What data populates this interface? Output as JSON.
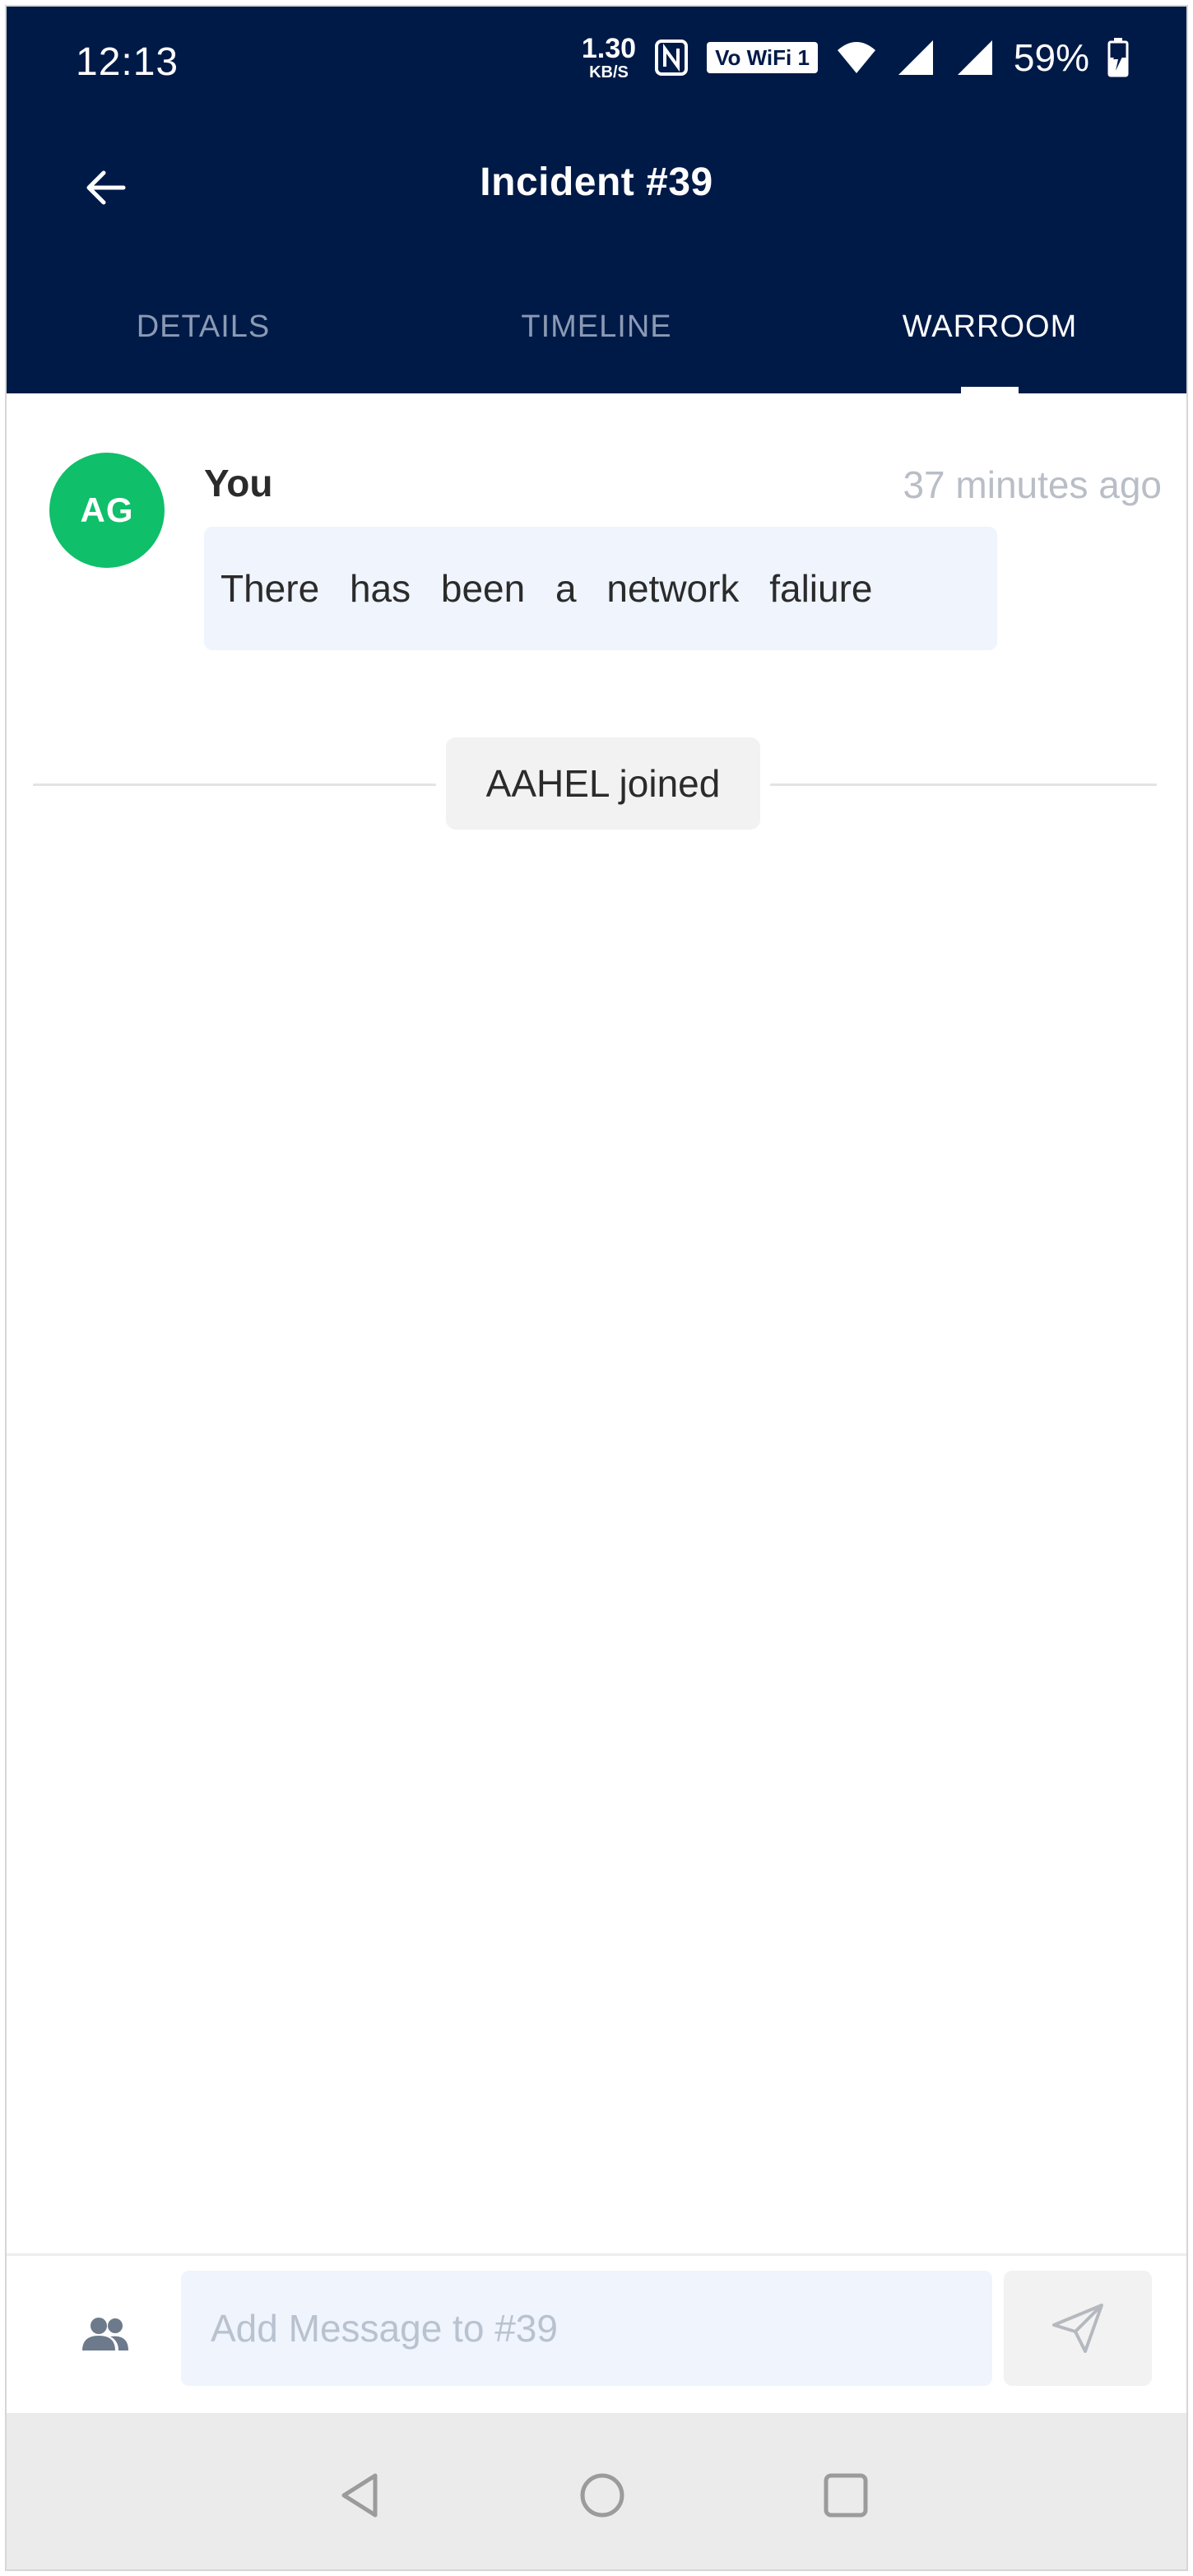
{
  "status_bar": {
    "time": "12:13",
    "speed_value": "1.30",
    "speed_unit": "KB/S",
    "wifi_badge": "Vo WiFi 1",
    "battery_percent": "59%"
  },
  "app_bar": {
    "title": "Incident #39",
    "back_icon": "arrow-left-icon"
  },
  "tabs": [
    {
      "label": "DETAILS",
      "active": false
    },
    {
      "label": "TIMELINE",
      "active": false
    },
    {
      "label": "WARROOM",
      "active": true
    }
  ],
  "messages": [
    {
      "avatar_initials": "AG",
      "avatar_color": "#0fbf6a",
      "author": "You",
      "time": "37 minutes ago",
      "text": "There has been a network faliure"
    }
  ],
  "system_events": [
    {
      "text": "AAHEL joined"
    }
  ],
  "composer": {
    "placeholder": "Add Message to #39",
    "people_icon": "people-icon",
    "send_icon": "send-icon"
  },
  "colors": {
    "header_bg": "#001a47",
    "accent_green": "#0fbf6a",
    "bubble_bg": "#eff4fd"
  }
}
